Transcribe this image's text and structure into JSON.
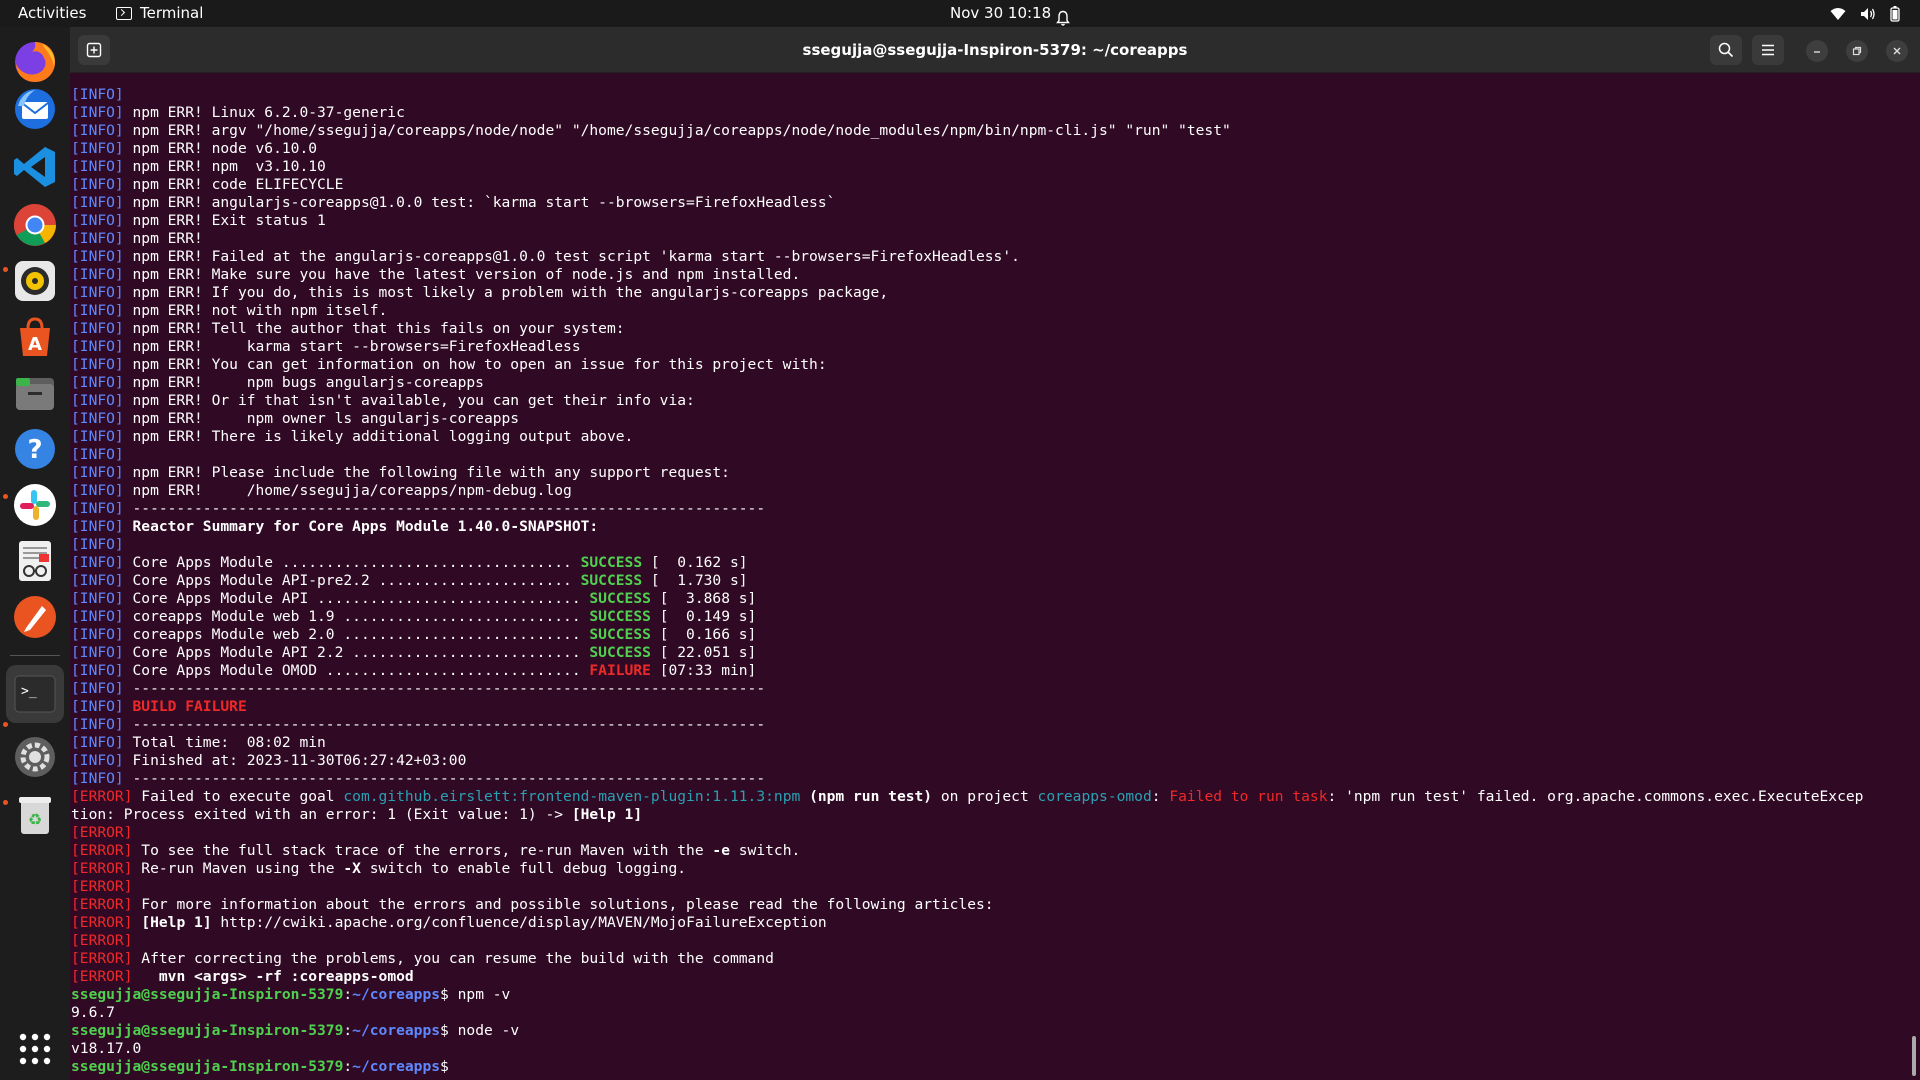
{
  "topbar": {
    "activities": "Activities",
    "app_name": "Terminal",
    "clock": "Nov 30  10:18"
  },
  "dock": {
    "items": [
      "firefox-icon",
      "thunderbird-icon",
      "vscode-icon",
      "chrome-icon",
      "rhythmbox-icon",
      "app-center-icon",
      "files-icon",
      "help-icon",
      "slack-icon",
      "document-viewer-icon",
      "inkscape-icon",
      "terminal-icon",
      "settings-icon",
      "trash-icon",
      "show-apps-icon"
    ]
  },
  "window": {
    "title": "ssegujja@ssegujja-Inspiron-5379: ~/coreapps"
  },
  "colors": {
    "terminal_bg": "#300a24",
    "info": "#5f88ff",
    "error": "#ef2929",
    "success": "#4fd14f",
    "cyan": "#2aa1b3"
  },
  "terminal": {
    "lines": [
      [
        [
          "info",
          "[INFO]"
        ]
      ],
      [
        [
          "info",
          "[INFO]"
        ],
        [
          "n",
          " npm ERR! Linux 6.2.0-37-generic"
        ]
      ],
      [
        [
          "info",
          "[INFO]"
        ],
        [
          "n",
          " npm ERR! argv \"/home/ssegujja/coreapps/node/node\" \"/home/ssegujja/coreapps/node/node_modules/npm/bin/npm-cli.js\" \"run\" \"test\""
        ]
      ],
      [
        [
          "info",
          "[INFO]"
        ],
        [
          "n",
          " npm ERR! node v6.10.0"
        ]
      ],
      [
        [
          "info",
          "[INFO]"
        ],
        [
          "n",
          " npm ERR! npm  v3.10.10"
        ]
      ],
      [
        [
          "info",
          "[INFO]"
        ],
        [
          "n",
          " npm ERR! code ELIFECYCLE"
        ]
      ],
      [
        [
          "info",
          "[INFO]"
        ],
        [
          "n",
          " npm ERR! angularjs-coreapps@1.0.0 test: `karma start --browsers=FirefoxHeadless`"
        ]
      ],
      [
        [
          "info",
          "[INFO]"
        ],
        [
          "n",
          " npm ERR! Exit status 1"
        ]
      ],
      [
        [
          "info",
          "[INFO]"
        ],
        [
          "n",
          " npm ERR!"
        ]
      ],
      [
        [
          "info",
          "[INFO]"
        ],
        [
          "n",
          " npm ERR! Failed at the angularjs-coreapps@1.0.0 test script 'karma start --browsers=FirefoxHeadless'."
        ]
      ],
      [
        [
          "info",
          "[INFO]"
        ],
        [
          "n",
          " npm ERR! Make sure you have the latest version of node.js and npm installed."
        ]
      ],
      [
        [
          "info",
          "[INFO]"
        ],
        [
          "n",
          " npm ERR! If you do, this is most likely a problem with the angularjs-coreapps package,"
        ]
      ],
      [
        [
          "info",
          "[INFO]"
        ],
        [
          "n",
          " npm ERR! not with npm itself."
        ]
      ],
      [
        [
          "info",
          "[INFO]"
        ],
        [
          "n",
          " npm ERR! Tell the author that this fails on your system:"
        ]
      ],
      [
        [
          "info",
          "[INFO]"
        ],
        [
          "n",
          " npm ERR!     karma start --browsers=FirefoxHeadless"
        ]
      ],
      [
        [
          "info",
          "[INFO]"
        ],
        [
          "n",
          " npm ERR! You can get information on how to open an issue for this project with:"
        ]
      ],
      [
        [
          "info",
          "[INFO]"
        ],
        [
          "n",
          " npm ERR!     npm bugs angularjs-coreapps"
        ]
      ],
      [
        [
          "info",
          "[INFO]"
        ],
        [
          "n",
          " npm ERR! Or if that isn't available, you can get their info via:"
        ]
      ],
      [
        [
          "info",
          "[INFO]"
        ],
        [
          "n",
          " npm ERR!     npm owner ls angularjs-coreapps"
        ]
      ],
      [
        [
          "info",
          "[INFO]"
        ],
        [
          "n",
          " npm ERR! There is likely additional logging output above."
        ]
      ],
      [
        [
          "info",
          "[INFO]"
        ]
      ],
      [
        [
          "info",
          "[INFO]"
        ],
        [
          "n",
          " npm ERR! Please include the following file with any support request:"
        ]
      ],
      [
        [
          "info",
          "[INFO]"
        ],
        [
          "n",
          " npm ERR!     /home/ssegujja/coreapps/npm-debug.log"
        ]
      ],
      [
        [
          "info",
          "[INFO]"
        ],
        [
          "n",
          " ------------------------------------------------------------------------"
        ]
      ],
      [
        [
          "info",
          "[INFO]"
        ],
        [
          "n",
          " "
        ],
        [
          "b",
          "Reactor Summary for Core Apps Module 1.40.0-SNAPSHOT:"
        ]
      ],
      [
        [
          "info",
          "[INFO]"
        ]
      ],
      [
        [
          "info",
          "[INFO]"
        ],
        [
          "n",
          " Core Apps Module ................................. "
        ],
        [
          "succ",
          "SUCCESS"
        ],
        [
          "n",
          " [  0.162 s]"
        ]
      ],
      [
        [
          "info",
          "[INFO]"
        ],
        [
          "n",
          " Core Apps Module API-pre2.2 ...................... "
        ],
        [
          "succ",
          "SUCCESS"
        ],
        [
          "n",
          " [  1.730 s]"
        ]
      ],
      [
        [
          "info",
          "[INFO]"
        ],
        [
          "n",
          " Core Apps Module API .............................. "
        ],
        [
          "succ",
          "SUCCESS"
        ],
        [
          "n",
          " [  3.868 s]"
        ]
      ],
      [
        [
          "info",
          "[INFO]"
        ],
        [
          "n",
          " coreapps Module web 1.9 ........................... "
        ],
        [
          "succ",
          "SUCCESS"
        ],
        [
          "n",
          " [  0.149 s]"
        ]
      ],
      [
        [
          "info",
          "[INFO]"
        ],
        [
          "n",
          " coreapps Module web 2.0 ........................... "
        ],
        [
          "succ",
          "SUCCESS"
        ],
        [
          "n",
          " [  0.166 s]"
        ]
      ],
      [
        [
          "info",
          "[INFO]"
        ],
        [
          "n",
          " Core Apps Module API 2.2 .......................... "
        ],
        [
          "succ",
          "SUCCESS"
        ],
        [
          "n",
          " [ 22.051 s]"
        ]
      ],
      [
        [
          "info",
          "[INFO]"
        ],
        [
          "n",
          " Core Apps Module OMOD ............................. "
        ],
        [
          "fail",
          "FAILURE"
        ],
        [
          "n",
          " [07:33 min]"
        ]
      ],
      [
        [
          "info",
          "[INFO]"
        ],
        [
          "n",
          " ------------------------------------------------------------------------"
        ]
      ],
      [
        [
          "info",
          "[INFO]"
        ],
        [
          "n",
          " "
        ],
        [
          "fail",
          "BUILD FAILURE"
        ]
      ],
      [
        [
          "info",
          "[INFO]"
        ],
        [
          "n",
          " ------------------------------------------------------------------------"
        ]
      ],
      [
        [
          "info",
          "[INFO]"
        ],
        [
          "n",
          " Total time:  08:02 min"
        ]
      ],
      [
        [
          "info",
          "[INFO]"
        ],
        [
          "n",
          " Finished at: 2023-11-30T06:27:42+03:00"
        ]
      ],
      [
        [
          "info",
          "[INFO]"
        ],
        [
          "n",
          " ------------------------------------------------------------------------"
        ]
      ],
      [
        [
          "err",
          "[ERROR]"
        ],
        [
          "n",
          " Failed to execute goal "
        ],
        [
          "cyan",
          "com.github.eirslett:frontend-maven-plugin:1.11.3:npm"
        ],
        [
          "n",
          " "
        ],
        [
          "b",
          "(npm run test)"
        ],
        [
          "n",
          " on project "
        ],
        [
          "cyan",
          "coreapps-omod"
        ],
        [
          "n",
          ": "
        ],
        [
          "err",
          "Failed to run task"
        ],
        [
          "n",
          ": 'npm run test' failed. org.apache.commons.exec.ExecuteExcep"
        ]
      ],
      [
        [
          "n",
          "tion: Process exited with an error: 1 (Exit value: 1) -> "
        ],
        [
          "b",
          "[Help 1]"
        ]
      ],
      [
        [
          "err",
          "[ERROR]"
        ]
      ],
      [
        [
          "err",
          "[ERROR]"
        ],
        [
          "n",
          " To see the full stack trace of the errors, re-run Maven with the "
        ],
        [
          "b",
          "-e"
        ],
        [
          "n",
          " switch."
        ]
      ],
      [
        [
          "err",
          "[ERROR]"
        ],
        [
          "n",
          " Re-run Maven using the "
        ],
        [
          "b",
          "-X"
        ],
        [
          "n",
          " switch to enable full debug logging."
        ]
      ],
      [
        [
          "err",
          "[ERROR]"
        ]
      ],
      [
        [
          "err",
          "[ERROR]"
        ],
        [
          "n",
          " For more information about the errors and possible solutions, please read the following articles:"
        ]
      ],
      [
        [
          "err",
          "[ERROR]"
        ],
        [
          "n",
          " "
        ],
        [
          "b",
          "[Help 1]"
        ],
        [
          "n",
          " http://cwiki.apache.org/confluence/display/MAVEN/MojoFailureException"
        ]
      ],
      [
        [
          "err",
          "[ERROR]"
        ]
      ],
      [
        [
          "err",
          "[ERROR]"
        ],
        [
          "n",
          " After correcting the problems, you can resume the build with the command"
        ]
      ],
      [
        [
          "err",
          "[ERROR]"
        ],
        [
          "n",
          "   "
        ],
        [
          "b",
          "mvn <args> -rf :coreapps-omod"
        ]
      ],
      [
        [
          "user",
          "ssegujja@ssegujja-Inspiron-5379"
        ],
        [
          "n",
          ":"
        ],
        [
          "path",
          "~/coreapps"
        ],
        [
          "n",
          "$ npm -v"
        ]
      ],
      [
        [
          "n",
          "9.6.7"
        ]
      ],
      [
        [
          "user",
          "ssegujja@ssegujja-Inspiron-5379"
        ],
        [
          "n",
          ":"
        ],
        [
          "path",
          "~/coreapps"
        ],
        [
          "n",
          "$ node -v"
        ]
      ],
      [
        [
          "n",
          "v18.17.0"
        ]
      ],
      [
        [
          "user",
          "ssegujja@ssegujja-Inspiron-5379"
        ],
        [
          "n",
          ":"
        ],
        [
          "path",
          "~/coreapps"
        ],
        [
          "n",
          "$ "
        ]
      ]
    ]
  }
}
